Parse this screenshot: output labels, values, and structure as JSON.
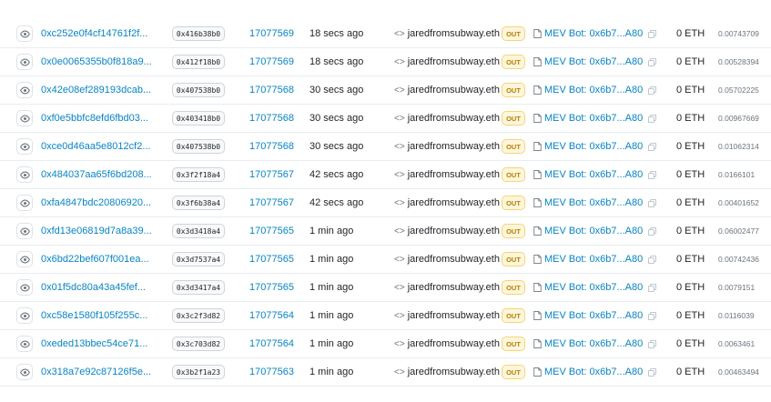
{
  "rows": [
    {
      "hash": "0xc252e0f4cf14761f2f...",
      "method": "0x416b38b0",
      "block": "17077569",
      "age": "18 secs ago",
      "from": "jaredfromsubway.eth",
      "direction": "OUT",
      "to": "MEV Bot: 0x6b7...A80",
      "value": "0 ETH",
      "fee": "0.00743709"
    },
    {
      "hash": "0x0e0065355b0f818a9...",
      "method": "0x412f18b0",
      "block": "17077569",
      "age": "18 secs ago",
      "from": "jaredfromsubway.eth",
      "direction": "OUT",
      "to": "MEV Bot: 0x6b7...A80",
      "value": "0 ETH",
      "fee": "0.00528394"
    },
    {
      "hash": "0x42e08ef289193dcab...",
      "method": "0x407538b0",
      "block": "17077568",
      "age": "30 secs ago",
      "from": "jaredfromsubway.eth",
      "direction": "OUT",
      "to": "MEV Bot: 0x6b7...A80",
      "value": "0 ETH",
      "fee": "0.05702225"
    },
    {
      "hash": "0xf0e5bbfc8efd6fbd03...",
      "method": "0x403418b0",
      "block": "17077568",
      "age": "30 secs ago",
      "from": "jaredfromsubway.eth",
      "direction": "OUT",
      "to": "MEV Bot: 0x6b7...A80",
      "value": "0 ETH",
      "fee": "0.00967669"
    },
    {
      "hash": "0xce0d46aa5e8012cf2...",
      "method": "0x407538b0",
      "block": "17077568",
      "age": "30 secs ago",
      "from": "jaredfromsubway.eth",
      "direction": "OUT",
      "to": "MEV Bot: 0x6b7...A80",
      "value": "0 ETH",
      "fee": "0.01062314"
    },
    {
      "hash": "0x484037aa65f6bd208...",
      "method": "0x3f2f18a4",
      "block": "17077567",
      "age": "42 secs ago",
      "from": "jaredfromsubway.eth",
      "direction": "OUT",
      "to": "MEV Bot: 0x6b7...A80",
      "value": "0 ETH",
      "fee": "0.0166101"
    },
    {
      "hash": "0xfa4847bdc20806920...",
      "method": "0x3f6b38a4",
      "block": "17077567",
      "age": "42 secs ago",
      "from": "jaredfromsubway.eth",
      "direction": "OUT",
      "to": "MEV Bot: 0x6b7...A80",
      "value": "0 ETH",
      "fee": "0.00401652"
    },
    {
      "hash": "0xfd13e06819d7a8a39...",
      "method": "0x3d3418a4",
      "block": "17077565",
      "age": "1 min ago",
      "from": "jaredfromsubway.eth",
      "direction": "OUT",
      "to": "MEV Bot: 0x6b7...A80",
      "value": "0 ETH",
      "fee": "0.06002477"
    },
    {
      "hash": "0x6bd22bef607f001ea...",
      "method": "0x3d7537a4",
      "block": "17077565",
      "age": "1 min ago",
      "from": "jaredfromsubway.eth",
      "direction": "OUT",
      "to": "MEV Bot: 0x6b7...A80",
      "value": "0 ETH",
      "fee": "0.00742436"
    },
    {
      "hash": "0x01f5dc80a43a45fef...",
      "method": "0x3d3417a4",
      "block": "17077565",
      "age": "1 min ago",
      "from": "jaredfromsubway.eth",
      "direction": "OUT",
      "to": "MEV Bot: 0x6b7...A80",
      "value": "0 ETH",
      "fee": "0.0079151"
    },
    {
      "hash": "0xc58e1580f105f255c...",
      "method": "0x3c2f3d82",
      "block": "17077564",
      "age": "1 min ago",
      "from": "jaredfromsubway.eth",
      "direction": "OUT",
      "to": "MEV Bot: 0x6b7...A80",
      "value": "0 ETH",
      "fee": "0.0116039"
    },
    {
      "hash": "0xeded13bbec54ce71...",
      "method": "0x3c703d82",
      "block": "17077564",
      "age": "1 min ago",
      "from": "jaredfromsubway.eth",
      "direction": "OUT",
      "to": "MEV Bot: 0x6b7...A80",
      "value": "0 ETH",
      "fee": "0.0063461"
    },
    {
      "hash": "0x318a7e92c87126f5e...",
      "method": "0x3b2f1a23",
      "block": "17077563",
      "age": "1 min ago",
      "from": "jaredfromsubway.eth",
      "direction": "OUT",
      "to": "MEV Bot: 0x6b7...A80",
      "value": "0 ETH",
      "fee": "0.00463494"
    }
  ]
}
